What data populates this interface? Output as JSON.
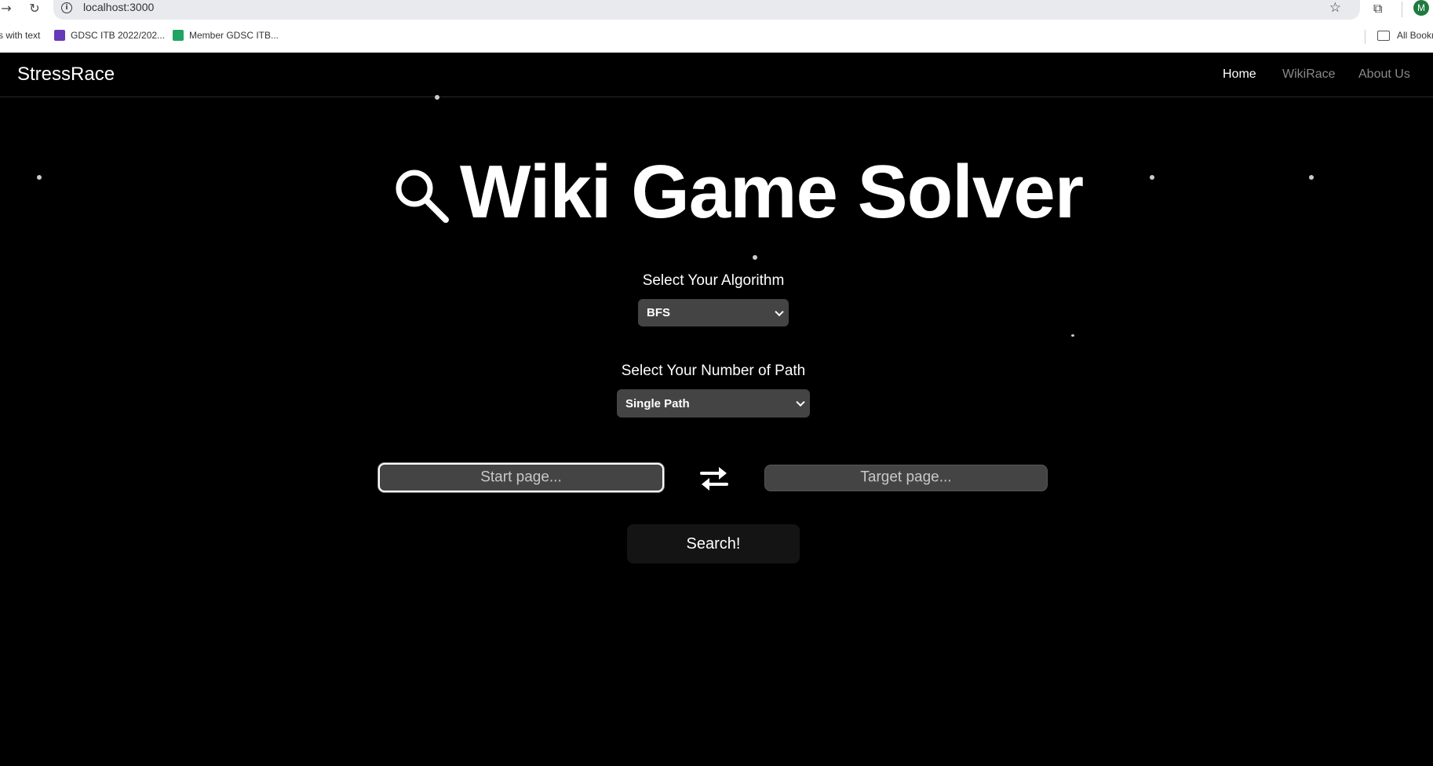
{
  "browser": {
    "url": "localhost:3000",
    "bookmarks": [
      {
        "label": "s with text"
      },
      {
        "label": "GDSC ITB 2022/202..."
      },
      {
        "label": "Member GDSC ITB..."
      }
    ],
    "all_bookmarks_label": "All Bookm",
    "profile_initial": "M"
  },
  "navbar": {
    "brand": "StressRace",
    "links": [
      {
        "label": "Home",
        "active": true
      },
      {
        "label": "WikiRace",
        "active": false
      },
      {
        "label": "About Us",
        "active": false
      }
    ]
  },
  "hero": {
    "title": "Wiki Game Solver",
    "icon": "search-icon"
  },
  "form": {
    "algorithm_label": "Select Your Algorithm",
    "algorithm_value": "BFS",
    "path_label": "Select Your Number of Path",
    "path_value": "Single Path",
    "start_placeholder": "Start page...",
    "target_placeholder": "Target page...",
    "swap_icon": "swap-arrows-icon",
    "search_label": "Search!"
  },
  "colors": {
    "background": "#000000",
    "input_bg": "#444444",
    "button_bg": "#141414",
    "text": "#ffffff",
    "muted_link": "#8a8a8a"
  }
}
